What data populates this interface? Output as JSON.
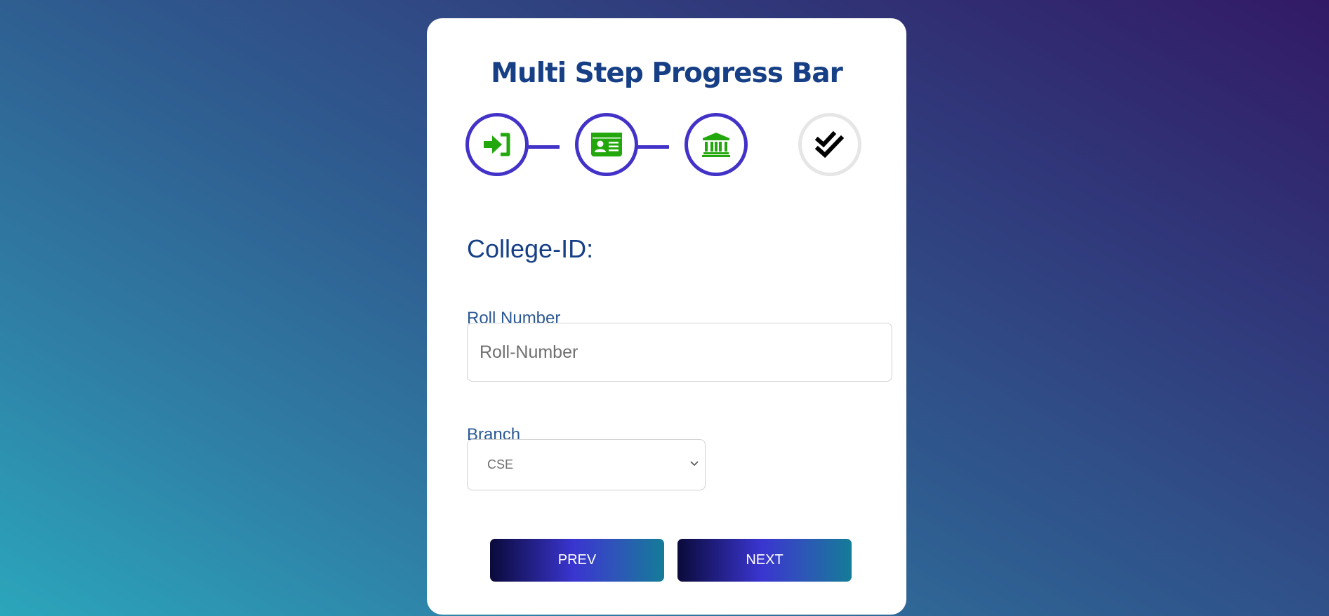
{
  "card": {
    "title": "Multi Step Progress Bar"
  },
  "steps": [
    {
      "icon": "sign-in-icon",
      "state": "completed"
    },
    {
      "icon": "id-card-icon",
      "state": "completed"
    },
    {
      "icon": "bank-icon",
      "state": "completed"
    },
    {
      "icon": "double-check-icon",
      "state": "pending"
    }
  ],
  "colors": {
    "accent": "#4232c8",
    "step_icon": "#22a80c",
    "heading": "#163f86",
    "pending_border": "#e6e6e6"
  },
  "form": {
    "heading": "College-ID:",
    "roll_label": "Roll Number",
    "roll_placeholder": "Roll-Number",
    "roll_value": "",
    "branch_label": "Branch",
    "branch_value": "CSE"
  },
  "buttons": {
    "prev_label": "PREV",
    "next_label": "NEXT"
  }
}
